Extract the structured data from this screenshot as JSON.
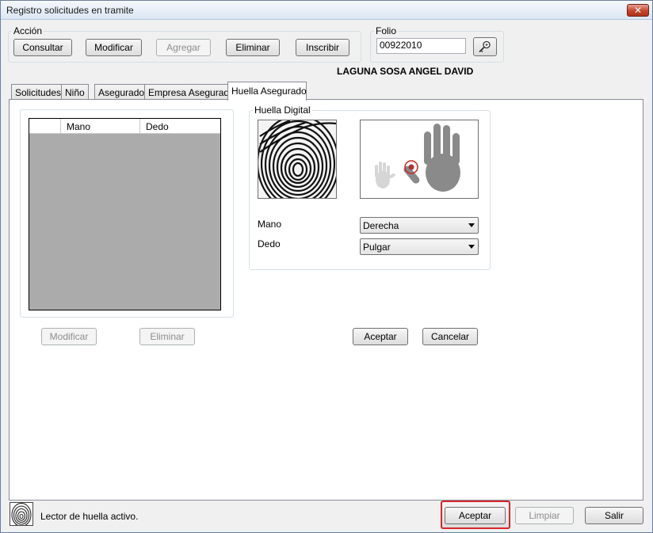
{
  "window": {
    "title": "Registro solicitudes en tramite",
    "close_glyph": "✕"
  },
  "accion": {
    "legend": "Acción",
    "consultar": "Consultar",
    "modificar": "Modificar",
    "agregar": "Agregar",
    "eliminar": "Eliminar",
    "inscribir": "Inscribir"
  },
  "folio": {
    "legend": "Folio",
    "value": "00922010",
    "search_icon": "key-search-icon"
  },
  "person_name": "LAGUNA SOSA ANGEL DAVID",
  "tabs": [
    {
      "label": "Solicitudes"
    },
    {
      "label": "Niño"
    },
    {
      "label": "Asegurado"
    },
    {
      "label": "Empresa Asegurado"
    },
    {
      "label": "Huella Asegurado"
    }
  ],
  "huella_panel": {
    "grid_columns": [
      "Mano",
      "Dedo"
    ],
    "modificar": "Modificar",
    "eliminar": "Eliminar",
    "group_legend": "Huella Digital",
    "mano_label": "Mano",
    "mano_value": "Derecha",
    "dedo_label": "Dedo",
    "dedo_value": "Pulgar",
    "aceptar": "Aceptar",
    "cancelar": "Cancelar"
  },
  "footer": {
    "status_text": "Lector de huella activo.",
    "aceptar": "Aceptar",
    "limpiar": "Limpiar",
    "salir": "Salir"
  },
  "colors": {
    "highlight": "#d7262d",
    "grid_bg": "#ababab"
  }
}
